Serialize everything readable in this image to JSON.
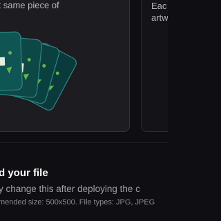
{
  "edition_options": {
    "left": {
      "description": "ct same piece of"
    },
    "right": {
      "description_line1": "Eac",
      "description_line2": "artw"
    }
  },
  "upload": {
    "title": "d your file",
    "note": "y change this after deploying the c",
    "hint": "mended size: 500x500. File types: JPG, JPEG"
  },
  "colors": {
    "background": "#0f0e12",
    "card": "#1d1c21",
    "tile_teal": "#0f5a56",
    "tile_dark": "#0a3d3d",
    "accent_green": "#67b54a"
  }
}
